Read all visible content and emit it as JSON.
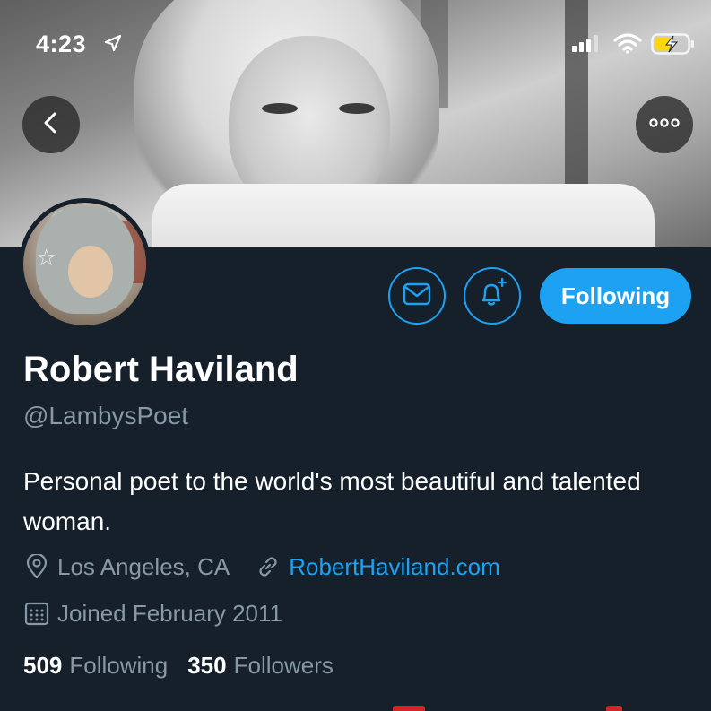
{
  "status_bar": {
    "time": "4:23",
    "icons": [
      "location-arrow-icon",
      "cellular-signal-icon",
      "wifi-icon",
      "battery-charging-icon"
    ]
  },
  "header": {
    "back_icon": "chevron-left-icon",
    "more_icon": "more-horizontal-icon"
  },
  "profile": {
    "name": "Robert Haviland",
    "handle": "@LambysPoet",
    "bio": "Personal poet to the world's most beautiful and talented woman.",
    "location": "Los Angeles, CA",
    "website": "RobertHaviland.com",
    "joined": "Joined February 2011",
    "following_count": "509",
    "following_label": "Following",
    "followers_count": "350",
    "followers_label": "Followers"
  },
  "actions": {
    "message_icon": "envelope-icon",
    "notify_icon": "bell-plus-icon",
    "follow_label": "Following"
  },
  "colors": {
    "background": "#15202b",
    "accent": "#1da1f2",
    "secondary_text": "#8899a6",
    "battery": "#ffd60a"
  }
}
